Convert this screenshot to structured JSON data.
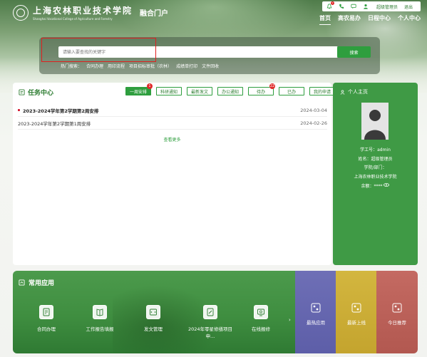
{
  "header": {
    "school_name_cn": "上海农林职业技术学院",
    "school_name_en": "Shanghai Vocational College of Agriculture and Forestry",
    "portal_name": "融合门户",
    "notification_count": "1",
    "admin_label": "超级管理员",
    "logout_label": "退出"
  },
  "nav": {
    "items": [
      "首页",
      "高农易办",
      "日程中心",
      "个人中心"
    ]
  },
  "search": {
    "placeholder": "请输入要查找的关键字",
    "button_label": "搜索",
    "hot_label": "热门搜索：",
    "hot_items": [
      "合同办理",
      "用印流程",
      "项目招标审批（农林）",
      "成绩单打印",
      "文件回收"
    ]
  },
  "task_center": {
    "title": "任务中心",
    "tabs": [
      {
        "label": "一周安排",
        "badge": "1"
      },
      {
        "label": "科研通知",
        "badge": ""
      },
      {
        "label": "最新发文",
        "badge": ""
      },
      {
        "label": "办公通知",
        "badge": ""
      },
      {
        "label": "待办",
        "badge": "22"
      },
      {
        "label": "已办",
        "badge": ""
      },
      {
        "label": "我的申请",
        "badge": ""
      }
    ],
    "rows": [
      {
        "title": "2023-2024学年第2学期第2周安排",
        "date": "2024-03-04"
      },
      {
        "title": "2023-2024学年第2学期第1周安排",
        "date": "2024-02-26"
      }
    ],
    "more_label": "查看更多"
  },
  "personal": {
    "title": "个人主页",
    "id_line": "学工号：admin",
    "name_line": "姓名：超级管理员",
    "dept_label": "学院/部门：",
    "dept_value": "上海农林职业技术学院",
    "balance_line": "余额：****"
  },
  "apps": {
    "title": "常用应用",
    "items": [
      "合同办理",
      "工作报告填报",
      "发文管理",
      "2024年零星修缮项目申...",
      "在线报修"
    ],
    "side": [
      "最热应用",
      "最新上线",
      "今日推荐"
    ]
  },
  "colors": {
    "brand_green": "#2e9e3e",
    "panel_green": "#3f9a45",
    "alert_red": "#e02b2b"
  }
}
